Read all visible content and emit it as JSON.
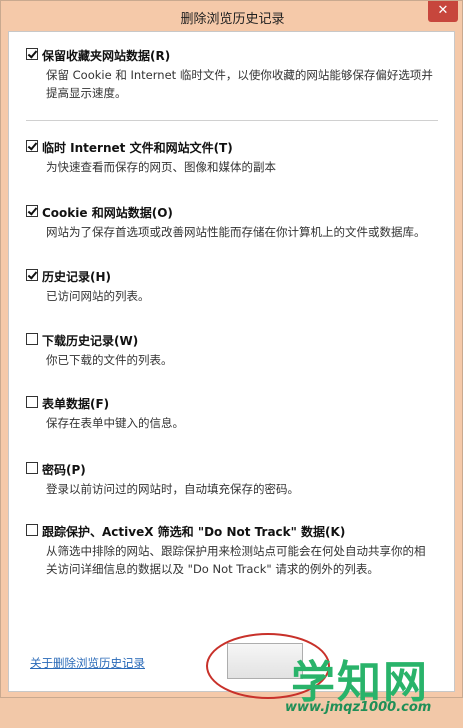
{
  "window": {
    "title": "删除浏览历史记录",
    "close_glyph": "✕"
  },
  "items": [
    {
      "label": "保留收藏夹网站数据(R)",
      "checked": true,
      "desc": "保留 Cookie 和 Internet 临时文件，以使你收藏的网站能够保存偏好选项并提高显示速度。"
    },
    {
      "label": "临时 Internet 文件和网站文件(T)",
      "checked": true,
      "desc": "为快速查看而保存的网页、图像和媒体的副本"
    },
    {
      "label": "Cookie 和网站数据(O)",
      "checked": true,
      "desc": "网站为了保存首选项或改善网站性能而存储在你计算机上的文件或数据库。"
    },
    {
      "label": "历史记录(H)",
      "checked": true,
      "desc": "已访问网站的列表。"
    },
    {
      "label": "下载历史记录(W)",
      "checked": false,
      "desc": "你已下载的文件的列表。"
    },
    {
      "label": "表单数据(F)",
      "checked": false,
      "desc": "保存在表单中键入的信息。"
    },
    {
      "label": "密码(P)",
      "checked": false,
      "desc": "登录以前访问过的网站时，自动填充保存的密码。"
    },
    {
      "label": "跟踪保护、ActiveX 筛选和 \"Do Not Track\" 数据(K)",
      "checked": false,
      "desc": "从筛选中排除的网站、跟踪保护用来检测站点可能会在何处自动共享你的相关访问详细信息的数据以及 \"Do Not Track\" 请求的例外的列表。"
    }
  ],
  "footer": {
    "link_text": "关于删除浏览历史记录"
  },
  "watermark": {
    "big": "学知网",
    "small": "www.jmqz1000.com"
  },
  "colors": {
    "accent_link": "#2a6ab8",
    "close": "#c7463c",
    "highlight": "#c8312a",
    "watermark": "#29b36a"
  }
}
